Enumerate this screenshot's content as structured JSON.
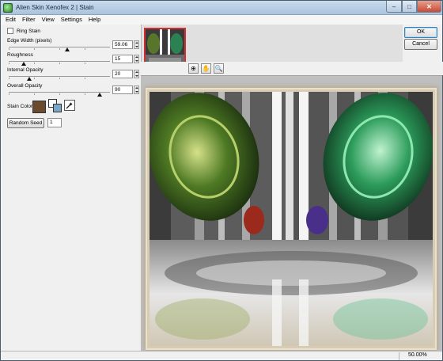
{
  "window": {
    "title": "Alien Skin Xenofex 2 | Stain"
  },
  "window_controls": {
    "minimize": "–",
    "maximize": "□",
    "close": "✕"
  },
  "menu": [
    "Edit",
    "Filter",
    "View",
    "Settings",
    "Help"
  ],
  "options": {
    "ring_stain_label": "Ring Stain",
    "ring_stain_checked": false
  },
  "params": [
    {
      "label": "Edge Width (pixels)",
      "value": "59.06",
      "level": 0.58
    },
    {
      "label": "Roughness",
      "value": "15",
      "level": 0.15
    },
    {
      "label": "Internal Opacity",
      "value": "20",
      "level": 0.2
    },
    {
      "label": "Overall Opacity",
      "value": "90",
      "level": 0.9
    }
  ],
  "stain": {
    "label": "Stain Color",
    "color": "#6b4a2e",
    "fg_color": "#ffffff",
    "bg_color": "#7aa6c8",
    "picker_icon": "eyedropper-icon"
  },
  "seed": {
    "button_label": "Random Seed",
    "value": "1"
  },
  "buttons": {
    "ok": "OK",
    "cancel": "Cancel"
  },
  "tools": [
    {
      "name": "preview-area-icon",
      "glyph": "⊕"
    },
    {
      "name": "hand-icon",
      "glyph": "✋"
    },
    {
      "name": "zoom-icon",
      "glyph": "🔍"
    }
  ],
  "status": {
    "zoom": "50.00%"
  }
}
